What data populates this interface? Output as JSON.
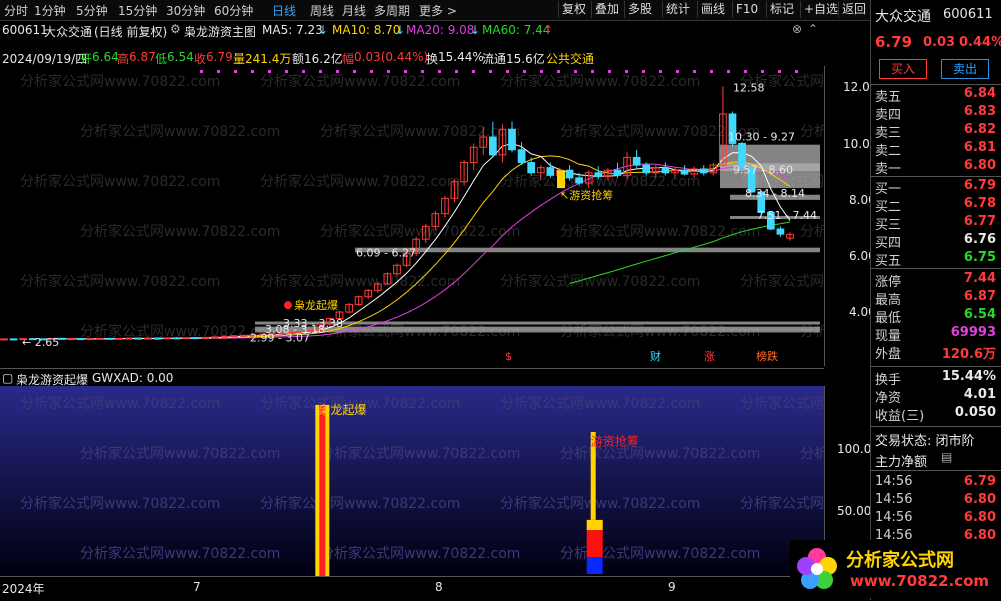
{
  "toolbar": {
    "periods": [
      "分时",
      "1分钟",
      "5分钟",
      "15分钟",
      "30分钟",
      "60分钟",
      "日线",
      "周线",
      "月线",
      "多周期",
      "更多 >"
    ],
    "active_index": 6,
    "buttons": [
      "复权",
      "叠加",
      "多股",
      "统计",
      "画线",
      "F10",
      "标记",
      "+自选",
      "返回"
    ]
  },
  "title_row": {
    "code": "600611",
    "name": "大众交通",
    "mode": "(日线 前复权)",
    "indicator": "枭龙游资主图",
    "ma5": "MA5: 7.23",
    "ma10": "MA10: 8.70",
    "ma20": "MA20: 9.08",
    "ma60": "MA60: 7.44"
  },
  "info_row": {
    "date": "2024/09/19/四",
    "open_label": "开",
    "open": "6.64",
    "high_label": "高",
    "high": "6.87",
    "low_label": "低",
    "low": "6.54",
    "close_label": "收",
    "close": "6.79",
    "vol_label": "量",
    "vol": "241.4万",
    "amount_label": "额",
    "amount": "16.2亿",
    "amp_label": "幅",
    "amp": "0.03(0.44%)",
    "turn_label": "换",
    "turn": "15.44%",
    "float_label": "流通",
    "float": "15.6亿",
    "industry": "公共交通"
  },
  "main_chart": {
    "y_ticks": [
      "12.00",
      "10.00",
      "8.00",
      "6.00",
      "4.00"
    ],
    "labels": {
      "peak": "12.58",
      "r1": "10.30 - 9.27",
      "r2": "9.57 - 8.60",
      "r3": "8.34 - 8.14",
      "r4": "7.51 - 7.44",
      "s1": "6.09 - 6.27",
      "s2": "3.33 - 3.38",
      "s3": "3.08 - 3.18",
      "s4": "2.99 - 3.07",
      "low": "2.65",
      "signal1": "枭龙起爆",
      "signal2": "游资抢筹"
    },
    "events": [
      "$",
      "财",
      "涨",
      "榜跌"
    ],
    "watermark": "分析家公式网www.70822.com"
  },
  "indicator": {
    "name": "枭龙游资起爆",
    "value": "GWXAD: 0.00",
    "y_ticks": [
      "100.0",
      "50.00"
    ],
    "signal1": "枭龙起爆",
    "signal2": "游资抢筹"
  },
  "xaxis": {
    "labels": [
      "2024年",
      "7",
      "8",
      "9"
    ]
  },
  "sidebar": {
    "name": "大众交通",
    "code": "600611",
    "price": "6.79",
    "change": "0.03",
    "pct": "0.44%",
    "buy_btn": "买入",
    "sell_btn": "卖出",
    "asks": [
      {
        "label": "卖五",
        "price": "6.84"
      },
      {
        "label": "卖四",
        "price": "6.83"
      },
      {
        "label": "卖三",
        "price": "6.82"
      },
      {
        "label": "卖二",
        "price": "6.81"
      },
      {
        "label": "卖一",
        "price": "6.80"
      }
    ],
    "bids": [
      {
        "label": "买一",
        "price": "6.79"
      },
      {
        "label": "买二",
        "price": "6.78"
      },
      {
        "label": "买三",
        "price": "6.77"
      },
      {
        "label": "买四",
        "price": "6.76"
      },
      {
        "label": "买五",
        "price": "6.75"
      }
    ],
    "stats": [
      {
        "label": "涨停",
        "value": "7.44"
      },
      {
        "label": "最高",
        "value": "6.87"
      },
      {
        "label": "最低",
        "value": "6.54"
      },
      {
        "label": "现量",
        "value": "69993"
      },
      {
        "label": "外盘",
        "value": "120.6万"
      }
    ],
    "stats2": [
      {
        "label": "换手",
        "value": "15.44%"
      },
      {
        "label": "净资",
        "value": "4.01"
      },
      {
        "label": "收益(三)",
        "value": "0.050"
      }
    ],
    "trade_status": "交易状态: 闭市阶",
    "net_label": "主力净额",
    "ticks": [
      {
        "time": "14:56",
        "price": "6.79"
      },
      {
        "time": "14:56",
        "price": "6.80"
      },
      {
        "time": "14:56",
        "price": "6.80"
      },
      {
        "time": "14:56",
        "price": "6.80"
      }
    ]
  },
  "logo": {
    "text": "分析家公式网",
    "url": "www.70822.com"
  },
  "chart_data": {
    "type": "candlestick",
    "y_range": [
      2.5,
      13.3
    ],
    "ma_colors": {
      "ma5": "#ffffff",
      "ma10": "#ffd400",
      "ma20": "#e040e0",
      "ma60": "#2bd62b"
    },
    "candles": [
      [
        2.7,
        2.72,
        2.66,
        2.7
      ],
      [
        2.7,
        2.71,
        2.65,
        2.68
      ],
      [
        2.68,
        2.72,
        2.66,
        2.71
      ],
      [
        2.71,
        2.73,
        2.68,
        2.7
      ],
      [
        2.7,
        2.72,
        2.67,
        2.69
      ],
      [
        2.69,
        2.73,
        2.68,
        2.72
      ],
      [
        2.72,
        2.74,
        2.69,
        2.7
      ],
      [
        2.7,
        2.72,
        2.67,
        2.71
      ],
      [
        2.71,
        2.73,
        2.68,
        2.69
      ],
      [
        2.69,
        2.72,
        2.67,
        2.71
      ],
      [
        2.71,
        2.74,
        2.69,
        2.72
      ],
      [
        2.72,
        2.74,
        2.7,
        2.71
      ],
      [
        2.71,
        2.73,
        2.69,
        2.72
      ],
      [
        2.72,
        2.75,
        2.7,
        2.73
      ],
      [
        2.73,
        2.75,
        2.7,
        2.71
      ],
      [
        2.71,
        2.74,
        2.69,
        2.73
      ],
      [
        2.73,
        2.76,
        2.71,
        2.72
      ],
      [
        2.72,
        2.75,
        2.7,
        2.74
      ],
      [
        2.74,
        2.77,
        2.72,
        2.73
      ],
      [
        2.73,
        2.76,
        2.71,
        2.75
      ],
      [
        2.75,
        2.78,
        2.73,
        2.74
      ],
      [
        2.74,
        2.77,
        2.72,
        2.76
      ],
      [
        2.76,
        2.8,
        2.74,
        2.78
      ],
      [
        2.78,
        2.82,
        2.76,
        2.8
      ],
      [
        2.8,
        2.84,
        2.78,
        2.82
      ],
      [
        2.82,
        2.86,
        2.8,
        2.84
      ],
      [
        2.84,
        2.88,
        2.82,
        2.85
      ],
      [
        2.85,
        2.9,
        2.83,
        2.88
      ],
      [
        2.88,
        2.92,
        2.85,
        2.9
      ],
      [
        2.9,
        2.95,
        2.88,
        2.93
      ],
      [
        2.93,
        2.98,
        2.9,
        2.95
      ],
      [
        2.95,
        3.0,
        2.92,
        2.98
      ],
      [
        2.98,
        3.05,
        2.96,
        3.03
      ],
      [
        3.03,
        3.3,
        3.01,
        3.28
      ],
      [
        3.28,
        3.52,
        3.24,
        3.5
      ],
      [
        3.5,
        3.8,
        3.45,
        3.75
      ],
      [
        3.75,
        4.1,
        3.7,
        4.05
      ],
      [
        4.05,
        4.4,
        3.98,
        4.35
      ],
      [
        4.35,
        4.65,
        4.25,
        4.6
      ],
      [
        4.6,
        4.95,
        4.5,
        4.85
      ],
      [
        4.85,
        5.3,
        4.8,
        5.25
      ],
      [
        5.25,
        5.65,
        5.15,
        5.58
      ],
      [
        5.58,
        6.1,
        5.5,
        6.05
      ],
      [
        6.05,
        6.7,
        5.95,
        6.6
      ],
      [
        6.6,
        7.2,
        6.45,
        7.1
      ],
      [
        7.1,
        7.7,
        6.95,
        7.6
      ],
      [
        7.6,
        8.3,
        7.45,
        8.2
      ],
      [
        8.2,
        8.95,
        8.05,
        8.85
      ],
      [
        8.85,
        9.7,
        8.7,
        9.6
      ],
      [
        9.6,
        10.35,
        9.3,
        10.2
      ],
      [
        10.2,
        11.0,
        9.9,
        10.6
      ],
      [
        10.6,
        11.2,
        9.8,
        9.9
      ],
      [
        9.9,
        11.1,
        9.6,
        10.9
      ],
      [
        10.9,
        11.2,
        10.0,
        10.1
      ],
      [
        10.1,
        10.4,
        9.5,
        9.6
      ],
      [
        9.6,
        9.8,
        9.1,
        9.2
      ],
      [
        9.2,
        9.5,
        8.9,
        9.4
      ],
      [
        9.4,
        9.6,
        9.0,
        9.1
      ],
      [
        9.1,
        9.4,
        8.8,
        9.3
      ],
      [
        9.3,
        9.5,
        8.9,
        9.0
      ],
      [
        9.0,
        9.2,
        8.7,
        8.8
      ],
      [
        8.8,
        9.3,
        8.6,
        9.2
      ],
      [
        9.2,
        9.45,
        8.95,
        9.05
      ],
      [
        9.05,
        9.4,
        8.9,
        9.3
      ],
      [
        9.3,
        9.6,
        9.0,
        9.1
      ],
      [
        9.1,
        10.0,
        8.95,
        9.8
      ],
      [
        9.8,
        10.1,
        9.4,
        9.5
      ],
      [
        9.5,
        9.6,
        9.1,
        9.2
      ],
      [
        9.2,
        9.5,
        9.0,
        9.4
      ],
      [
        9.4,
        9.6,
        9.1,
        9.2
      ],
      [
        9.2,
        9.4,
        9.0,
        9.3
      ],
      [
        9.3,
        9.5,
        9.1,
        9.15
      ],
      [
        9.15,
        9.45,
        9.0,
        9.35
      ],
      [
        9.35,
        9.5,
        9.1,
        9.2
      ],
      [
        9.2,
        9.6,
        9.1,
        9.5
      ],
      [
        9.5,
        12.58,
        9.45,
        11.5
      ],
      [
        11.5,
        11.6,
        10.2,
        10.35
      ],
      [
        10.35,
        10.4,
        9.3,
        9.4
      ],
      [
        9.4,
        9.45,
        8.4,
        8.45
      ],
      [
        8.45,
        8.5,
        7.6,
        7.65
      ],
      [
        7.65,
        7.7,
        6.95,
        7.0
      ],
      [
        7.0,
        7.1,
        6.7,
        6.8
      ],
      [
        6.64,
        6.87,
        6.54,
        6.79
      ]
    ],
    "zones": [
      {
        "lo": 9.27,
        "hi": 10.3
      },
      {
        "lo": 8.6,
        "hi": 9.57
      },
      {
        "lo": 8.14,
        "hi": 8.34
      },
      {
        "lo": 7.44,
        "hi": 7.51
      },
      {
        "lo": 6.09,
        "hi": 6.27
      },
      {
        "lo": 3.33,
        "hi": 3.38
      },
      {
        "lo": 3.08,
        "hi": 3.18
      },
      {
        "lo": 2.99,
        "hi": 3.07
      }
    ],
    "indicator_bars": [
      {
        "x_index": 33,
        "value": 100,
        "color": "#ffd400"
      },
      {
        "x_index": 61,
        "value": 40,
        "color": "#ff2020"
      }
    ]
  }
}
